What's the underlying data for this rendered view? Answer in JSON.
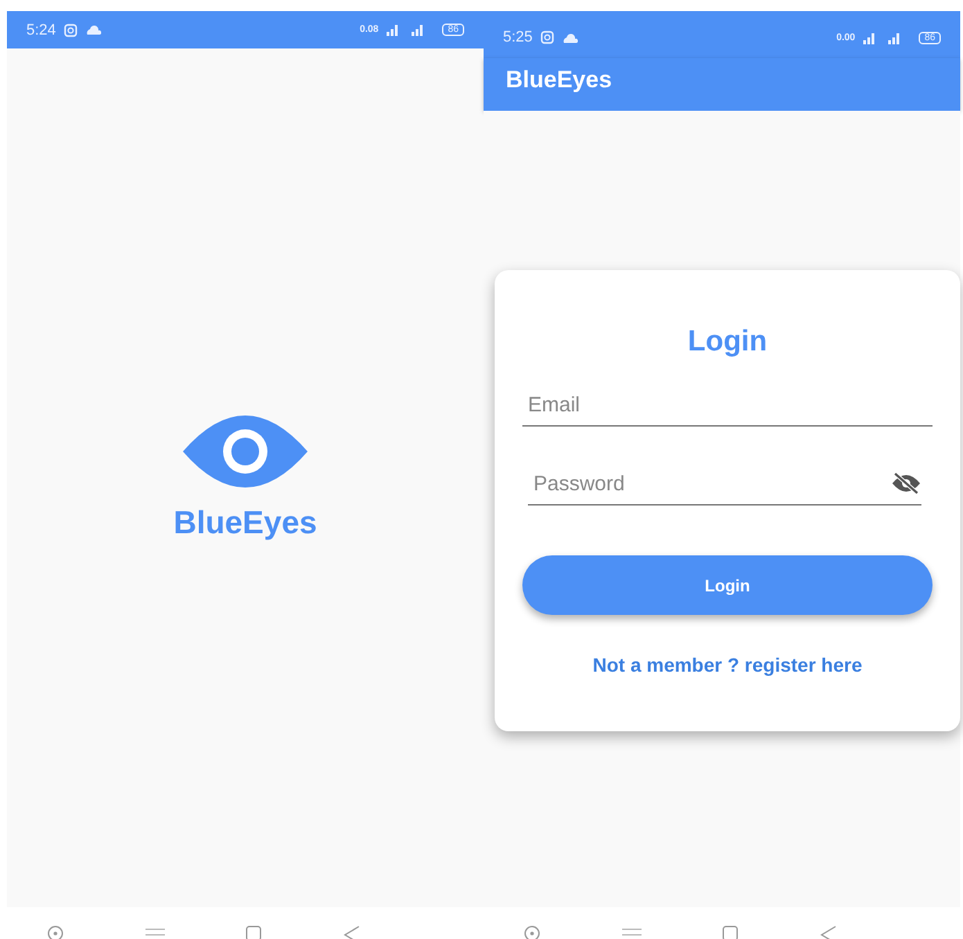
{
  "screens": [
    {
      "kind": "splash",
      "status_bar": {
        "time": "5:24",
        "speed": "0.08",
        "battery": "86"
      },
      "logo_text": "BlueEyes"
    },
    {
      "kind": "login",
      "status_bar": {
        "time": "5:25",
        "speed": "0.00",
        "battery": "86"
      },
      "app_bar": {
        "title": "BlueEyes"
      },
      "card": {
        "title": "Login",
        "email": {
          "placeholder": "Email"
        },
        "password": {
          "placeholder": "Password",
          "visible": false
        },
        "button": "Login",
        "link": "Not a member ? register here"
      }
    }
  ]
}
